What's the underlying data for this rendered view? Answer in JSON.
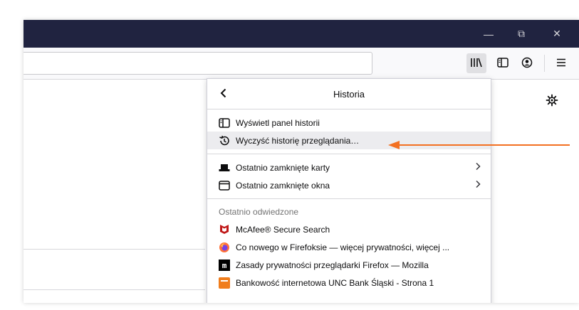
{
  "window": {
    "minimize_glyph": "—",
    "restore_glyph": "⧉",
    "close_glyph": "✕"
  },
  "toolbar": {
    "url_value": "",
    "buttons": [
      "library-icon",
      "sidebars-icon",
      "account-icon",
      "menu-icon"
    ]
  },
  "panel": {
    "title": "Historia",
    "items": [
      {
        "label": "Wyświetl panel historii",
        "icon": "sidebar-panel-icon"
      },
      {
        "label": "Wyczyść historię przeglądania…",
        "icon": "clear-history-icon"
      },
      {
        "label": "Ostatnio zamknięte karty",
        "icon": "closed-tab-icon"
      },
      {
        "label": "Ostatnio zamknięte okna",
        "icon": "closed-window-icon"
      }
    ],
    "recent_heading": "Ostatnio odwiedzone",
    "recent": [
      {
        "label": "McAfee® Secure Search",
        "icon": "mcafee-icon"
      },
      {
        "label": "Co nowego w Firefoksie — więcej prywatności, więcej ...",
        "icon": "firefox-icon"
      },
      {
        "label": "Zasady prywatności przeglądarki Firefox — Mozilla",
        "icon": "mozilla-icon"
      },
      {
        "label": "Bankowość internetowa UNC Bank Śląski - Strona 1",
        "icon": "bank-icon"
      }
    ]
  },
  "colors": {
    "titlebar": "#202340",
    "annotation_arrow": "#f37021"
  }
}
